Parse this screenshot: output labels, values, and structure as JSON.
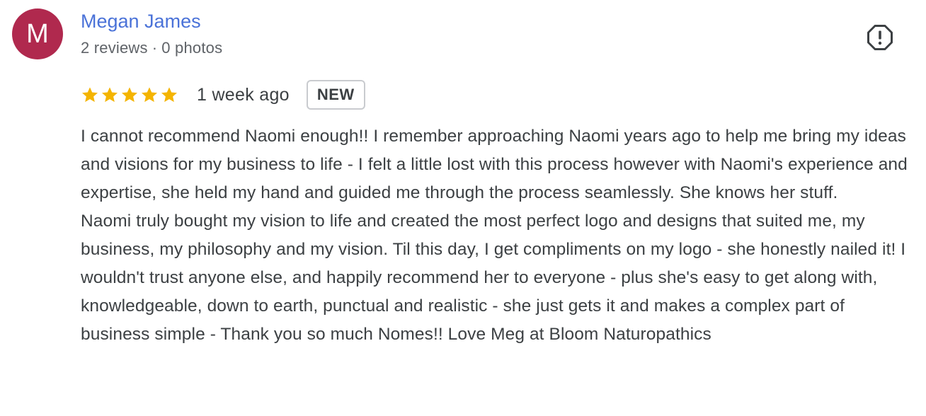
{
  "reviewer": {
    "avatar_initial": "M",
    "avatar_color": "#b0294e",
    "name": "Megan James",
    "reviews_count": "2 reviews",
    "separator": "·",
    "photos_count": "0 photos"
  },
  "report": {
    "icon": "report-flag-icon"
  },
  "rating": {
    "stars": 5,
    "max_stars": 5,
    "star_color": "#f4b400",
    "time_ago": "1 week ago",
    "badge": "NEW"
  },
  "review": {
    "paragraphs": [
      "I cannot recommend Naomi enough!! I remember approaching Naomi years ago to help me bring my ideas and visions for my business to life - I felt a little lost with this process however with Naomi's experience and expertise, she held my hand and guided me through the process seamlessly. She knows her stuff.",
      "Naomi truly bought my vision to life and created the most perfect logo and designs that suited me, my business, my philosophy and my vision. Til this day, I get compliments on my logo - she honestly nailed it! I wouldn't trust anyone else, and happily recommend her to everyone - plus she's easy to get along with, knowledgeable, down to earth, punctual and realistic - she just gets it and makes a complex part of business simple - Thank you so much Nomes!! Love Meg at Bloom Naturopathics"
    ]
  }
}
